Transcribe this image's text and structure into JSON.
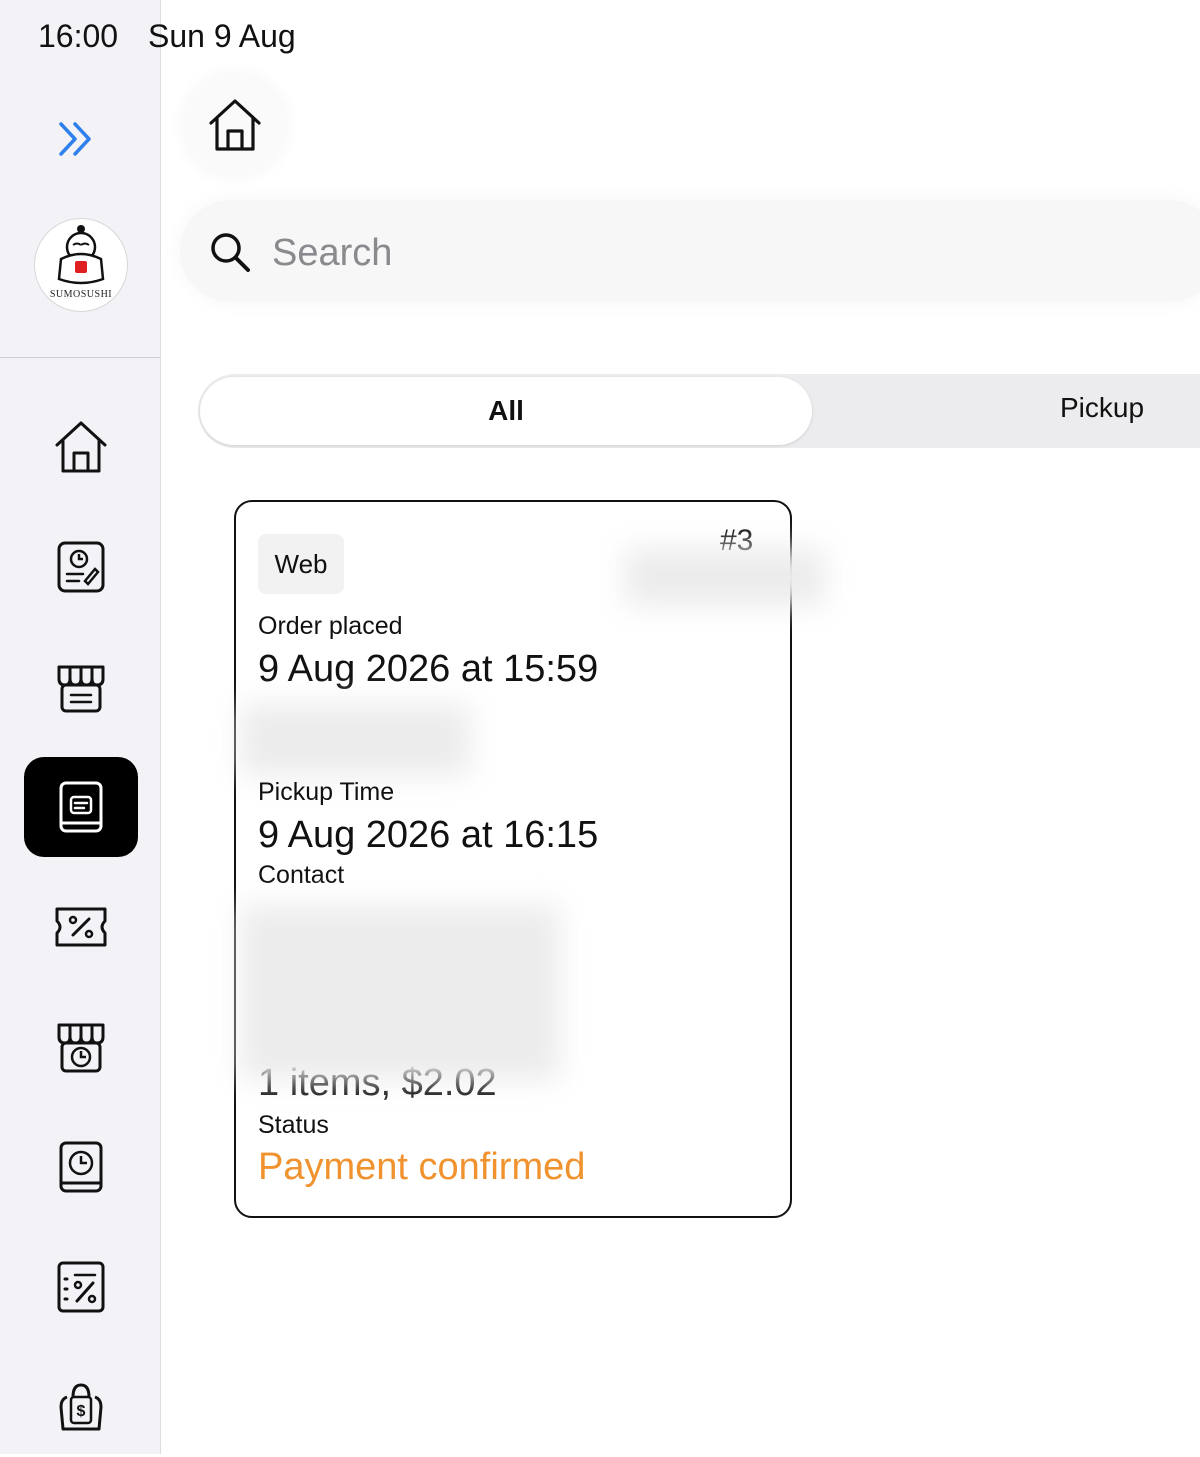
{
  "status_bar": {
    "time": "16:00",
    "date": "Sun 9 Aug"
  },
  "sidebar": {
    "logo_text": "SUMOSUSHI",
    "items": [
      {
        "icon": "home-icon"
      },
      {
        "icon": "order-history-icon"
      },
      {
        "icon": "store-icon"
      },
      {
        "icon": "orders-icon",
        "active": true
      },
      {
        "icon": "coupon-icon"
      },
      {
        "icon": "store-hours-icon"
      },
      {
        "icon": "schedule-icon"
      },
      {
        "icon": "discount-icon"
      },
      {
        "icon": "price-tag-icon"
      }
    ]
  },
  "search": {
    "placeholder": "Search"
  },
  "tabs": [
    {
      "label": "All",
      "selected": true
    },
    {
      "label": "Pickup",
      "selected": false
    }
  ],
  "order": {
    "source": "Web",
    "number": "#3",
    "order_placed_label": "Order placed",
    "order_placed_value": "9 Aug 2026 at 15:59",
    "pickup_time_label": "Pickup Time",
    "pickup_time_value": "9 Aug 2026 at 16:15",
    "contact_label": "Contact",
    "items_summary": "1 items, $2.02",
    "status_label": "Status",
    "status_value": "Payment confirmed",
    "status_color": "#f0922e"
  },
  "colors": {
    "accent": "#2f80ed",
    "sidebar_bg": "#f2f2f7"
  }
}
